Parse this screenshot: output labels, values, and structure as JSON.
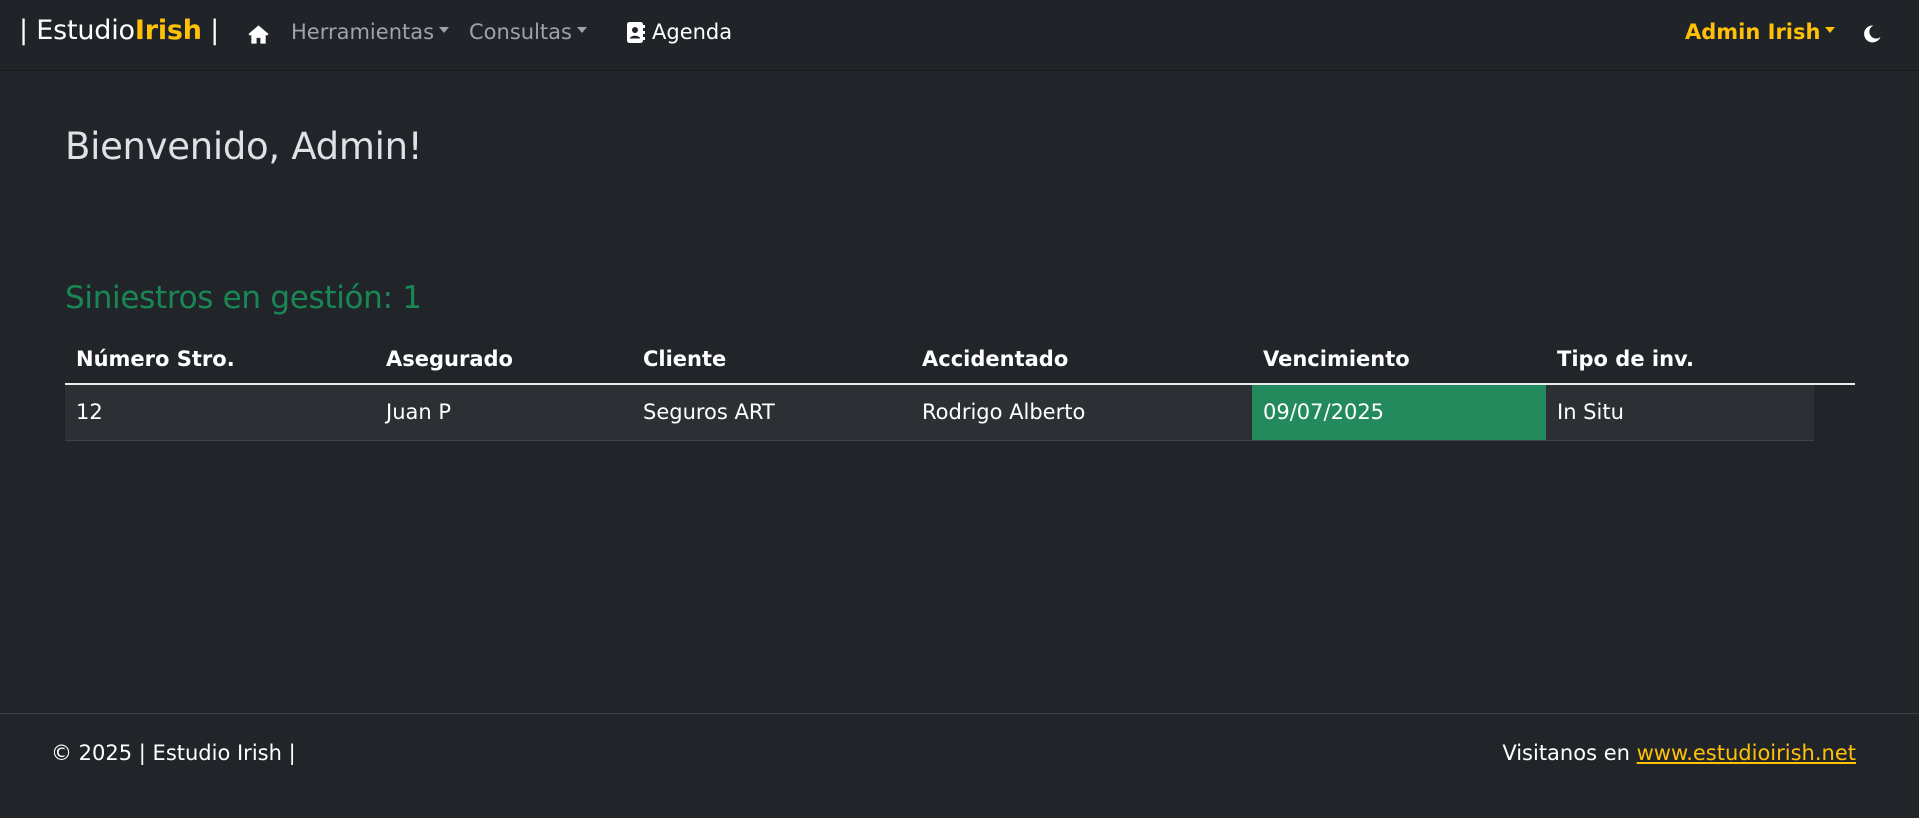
{
  "navbar": {
    "brand_prefix": "| Estudio",
    "brand_accent": "Irish",
    "brand_suffix": " |",
    "home_icon": "home-icon",
    "menu_tools": "Herramientas",
    "menu_queries": "Consultas",
    "agenda_label": "Agenda",
    "agenda_icon": "address-book-icon",
    "user_label": "Admin Irish",
    "theme_icon": "moon-icon"
  },
  "main": {
    "welcome": "Bienvenido, Admin!",
    "claims_title": "Siniestros en gestión: 1"
  },
  "table": {
    "headers": [
      "Número Stro.",
      "Asegurado",
      "Cliente",
      "Accidentado",
      "Vencimiento",
      "Tipo de inv."
    ],
    "rows": [
      [
        "12",
        "Juan P",
        "Seguros ART",
        "Rodrigo Alberto",
        "09/07/2025",
        "In Situ"
      ]
    ]
  },
  "footer": {
    "copyright": "© 2025 | Estudio Irish |",
    "visit_text": "Visitanos en ",
    "visit_link": "www.estudioirish.net"
  },
  "colors": {
    "accent": "#ffc107",
    "success": "#198754",
    "due_cell": "#228a5c",
    "background": "#212529"
  }
}
